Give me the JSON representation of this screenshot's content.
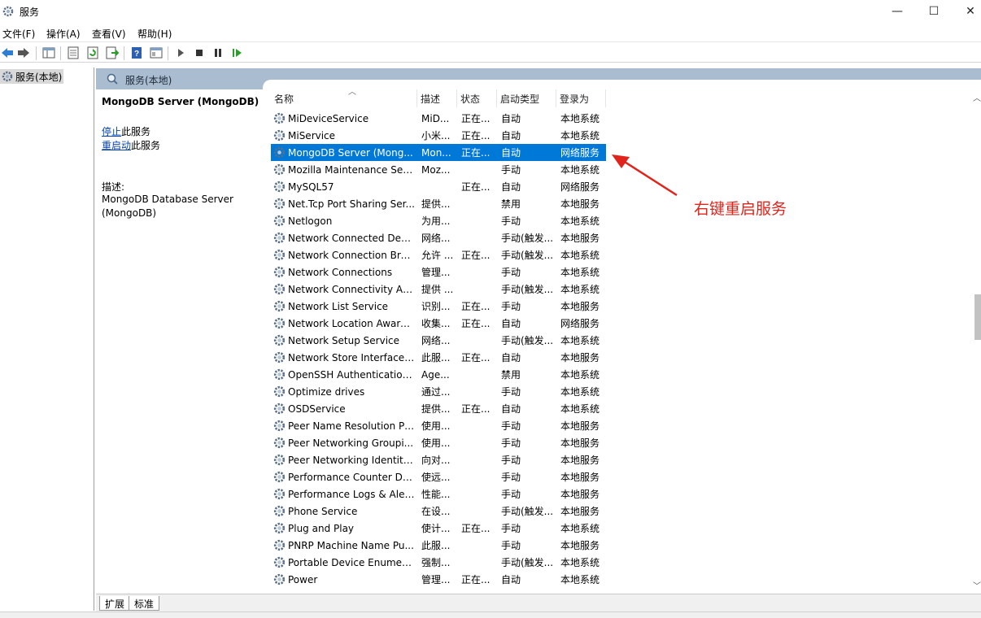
{
  "window": {
    "title": "服务",
    "minimize_glyph": "—",
    "maximize_glyph": "☐",
    "close_glyph": "✕"
  },
  "menu": [
    {
      "label": "文件(F)"
    },
    {
      "label": "操作(A)"
    },
    {
      "label": "查看(V)"
    },
    {
      "label": "帮助(H)"
    }
  ],
  "toolbar": {
    "icons": [
      "back-icon",
      "forward-icon",
      "console-tree-icon",
      "properties-icon",
      "refresh-icon",
      "export-icon",
      "help-icon",
      "view-icon",
      "start-icon",
      "stop-icon",
      "pause-icon",
      "restart-icon"
    ]
  },
  "tree": {
    "root_label": "服务(本地)"
  },
  "header": {
    "label": "服务(本地)"
  },
  "details": {
    "title": "MongoDB Server (MongoDB)",
    "stop_link": "停止",
    "stop_suffix": "此服务",
    "restart_link": "重启动",
    "restart_suffix": "此服务",
    "desc_label": "描述:",
    "desc_line1": "MongoDB Database Server",
    "desc_line2": "(MongoDB)"
  },
  "columns": {
    "name": "名称",
    "desc": "描述",
    "status": "状态",
    "startup": "启动类型",
    "logon": "登录为"
  },
  "services": [
    {
      "name": "MiDeviceService",
      "desc": "MiD...",
      "status": "正在...",
      "startup": "自动",
      "logon": "本地系统"
    },
    {
      "name": "MiService",
      "desc": "小米...",
      "status": "正在...",
      "startup": "自动",
      "logon": "本地系统"
    },
    {
      "name": "MongoDB Server (Mong...",
      "desc": "Mon...",
      "status": "正在...",
      "startup": "自动",
      "logon": "网络服务"
    },
    {
      "name": "Mozilla Maintenance Ser...",
      "desc": "Moz...",
      "status": "",
      "startup": "手动",
      "logon": "本地系统"
    },
    {
      "name": "MySQL57",
      "desc": "",
      "status": "正在...",
      "startup": "自动",
      "logon": "网络服务"
    },
    {
      "name": "Net.Tcp Port Sharing Ser...",
      "desc": "提供...",
      "status": "",
      "startup": "禁用",
      "logon": "本地服务"
    },
    {
      "name": "Netlogon",
      "desc": "为用...",
      "status": "",
      "startup": "手动",
      "logon": "本地系统"
    },
    {
      "name": "Network Connected Devi...",
      "desc": "网络...",
      "status": "",
      "startup": "手动(触发...",
      "logon": "本地服务"
    },
    {
      "name": "Network Connection Bro...",
      "desc": "允许 ...",
      "status": "正在...",
      "startup": "手动(触发...",
      "logon": "本地系统"
    },
    {
      "name": "Network Connections",
      "desc": "管理...",
      "status": "",
      "startup": "手动",
      "logon": "本地系统"
    },
    {
      "name": "Network Connectivity Ass...",
      "desc": "提供 ...",
      "status": "",
      "startup": "手动(触发...",
      "logon": "本地系统"
    },
    {
      "name": "Network List Service",
      "desc": "识别...",
      "status": "正在...",
      "startup": "手动",
      "logon": "本地服务"
    },
    {
      "name": "Network Location Aware...",
      "desc": "收集...",
      "status": "正在...",
      "startup": "自动",
      "logon": "网络服务"
    },
    {
      "name": "Network Setup Service",
      "desc": "网络...",
      "status": "",
      "startup": "手动(触发...",
      "logon": "本地系统"
    },
    {
      "name": "Network Store Interface ...",
      "desc": "此服...",
      "status": "正在...",
      "startup": "自动",
      "logon": "本地服务"
    },
    {
      "name": "OpenSSH Authentication ...",
      "desc": "Age...",
      "status": "",
      "startup": "禁用",
      "logon": "本地系统"
    },
    {
      "name": "Optimize drives",
      "desc": "通过...",
      "status": "",
      "startup": "手动",
      "logon": "本地系统"
    },
    {
      "name": "OSDService",
      "desc": "提供...",
      "status": "正在...",
      "startup": "自动",
      "logon": "本地系统"
    },
    {
      "name": "Peer Name Resolution Pr...",
      "desc": "使用...",
      "status": "",
      "startup": "手动",
      "logon": "本地服务"
    },
    {
      "name": "Peer Networking Groupi...",
      "desc": "使用...",
      "status": "",
      "startup": "手动",
      "logon": "本地服务"
    },
    {
      "name": "Peer Networking Identity...",
      "desc": "向对...",
      "status": "",
      "startup": "手动",
      "logon": "本地服务"
    },
    {
      "name": "Performance Counter DL...",
      "desc": "使远...",
      "status": "",
      "startup": "手动",
      "logon": "本地服务"
    },
    {
      "name": "Performance Logs & Aler...",
      "desc": "性能...",
      "status": "",
      "startup": "手动",
      "logon": "本地服务"
    },
    {
      "name": "Phone Service",
      "desc": "在设...",
      "status": "",
      "startup": "手动(触发...",
      "logon": "本地服务"
    },
    {
      "name": "Plug and Play",
      "desc": "使计...",
      "status": "正在...",
      "startup": "手动",
      "logon": "本地系统"
    },
    {
      "name": "PNRP Machine Name Pu...",
      "desc": "此服...",
      "status": "",
      "startup": "手动",
      "logon": "本地服务"
    },
    {
      "name": "Portable Device Enumera...",
      "desc": "强制...",
      "status": "",
      "startup": "手动(触发...",
      "logon": "本地系统"
    },
    {
      "name": "Power",
      "desc": "管理...",
      "status": "正在...",
      "startup": "自动",
      "logon": "本地系统"
    }
  ],
  "selected_index": 2,
  "annotation": {
    "text": "右键重启服务",
    "color": "#e0241b"
  },
  "tabs": [
    {
      "label": "扩展"
    },
    {
      "label": "标准"
    }
  ],
  "colors": {
    "selection": "#0078d7",
    "header_band": "#a9bcd0",
    "link": "#0645ad"
  }
}
